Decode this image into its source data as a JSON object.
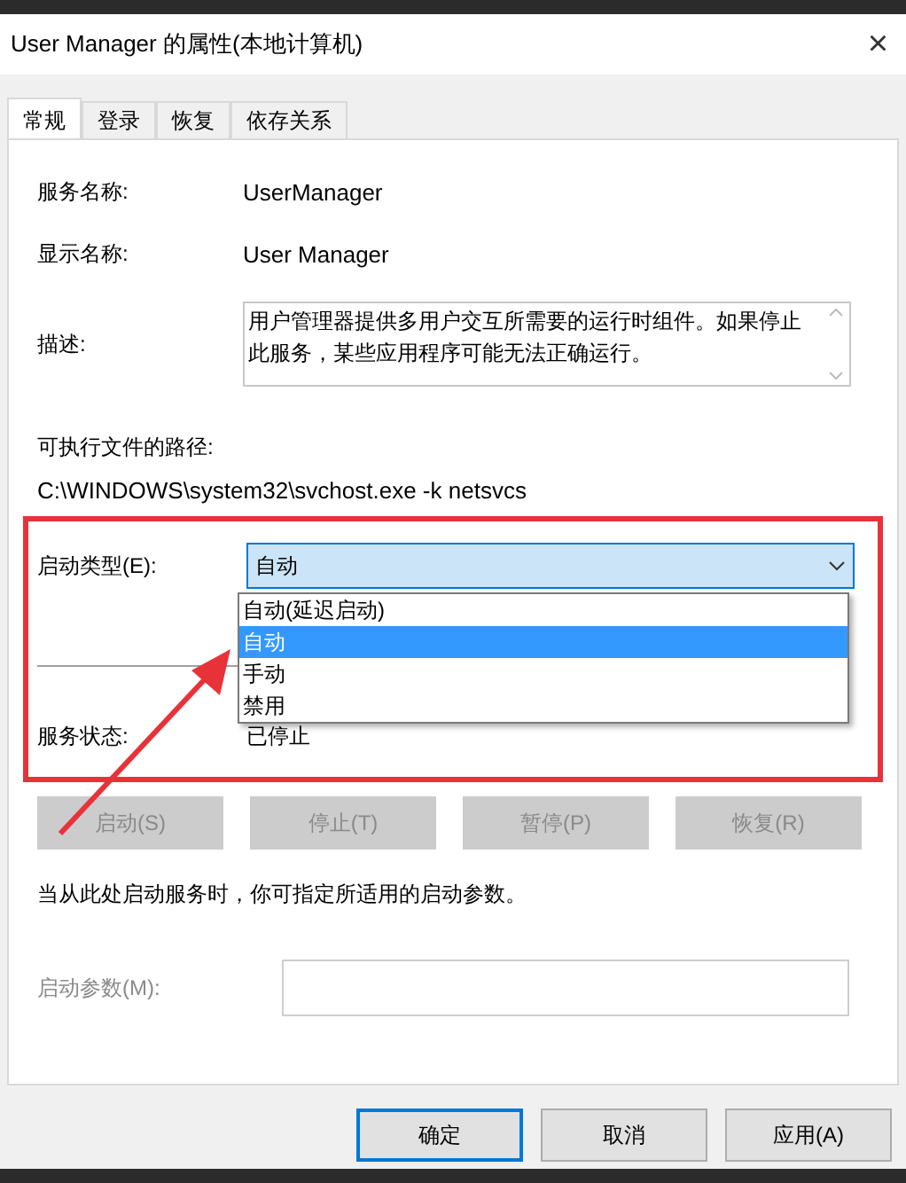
{
  "window": {
    "title": "User Manager 的属性(本地计算机)",
    "close": "×"
  },
  "tabs": [
    {
      "label": "常规",
      "selected": true
    },
    {
      "label": "登录",
      "selected": false
    },
    {
      "label": "恢复",
      "selected": false
    },
    {
      "label": "依存关系",
      "selected": false
    }
  ],
  "fields": [
    {
      "label": "服务名称:",
      "value": "UserManager"
    },
    {
      "label": "显示名称:",
      "value": "User Manager"
    }
  ],
  "description": {
    "label": "描述:",
    "value": "用户管理器提供多用户交互所需要的运行时组件。如果停止此服务，某些应用程序可能无法正确运行。"
  },
  "path": {
    "label": "可执行文件的路径:",
    "value": "C:\\WINDOWS\\system32\\svchost.exe -k netsvcs"
  },
  "startup_type": {
    "label": "启动类型(E):",
    "value": "自动",
    "expanded": true,
    "options": [
      {
        "label": "自动(延迟启动)",
        "selected": false
      },
      {
        "label": "自动",
        "selected": true
      },
      {
        "label": "手动",
        "selected": false
      },
      {
        "label": "禁用",
        "selected": false
      }
    ]
  },
  "service_status": {
    "label": "服务状态:",
    "value": "已停止"
  },
  "service_buttons": [
    {
      "label": "启动(S)",
      "disabled": true
    },
    {
      "label": "停止(T)",
      "disabled": true
    },
    {
      "label": "暂停(P)",
      "disabled": true
    },
    {
      "label": "恢复(R)",
      "disabled": true
    }
  ],
  "hint": "当从此处启动服务时，你可指定所适用的启动参数。",
  "start_parameters": {
    "label": "启动参数(M):",
    "disabled": true
  },
  "dialog_buttons": [
    {
      "label": "确定",
      "default": true
    },
    {
      "label": "取消",
      "default": false
    },
    {
      "label": "应用(A)",
      "default": false
    }
  ]
}
